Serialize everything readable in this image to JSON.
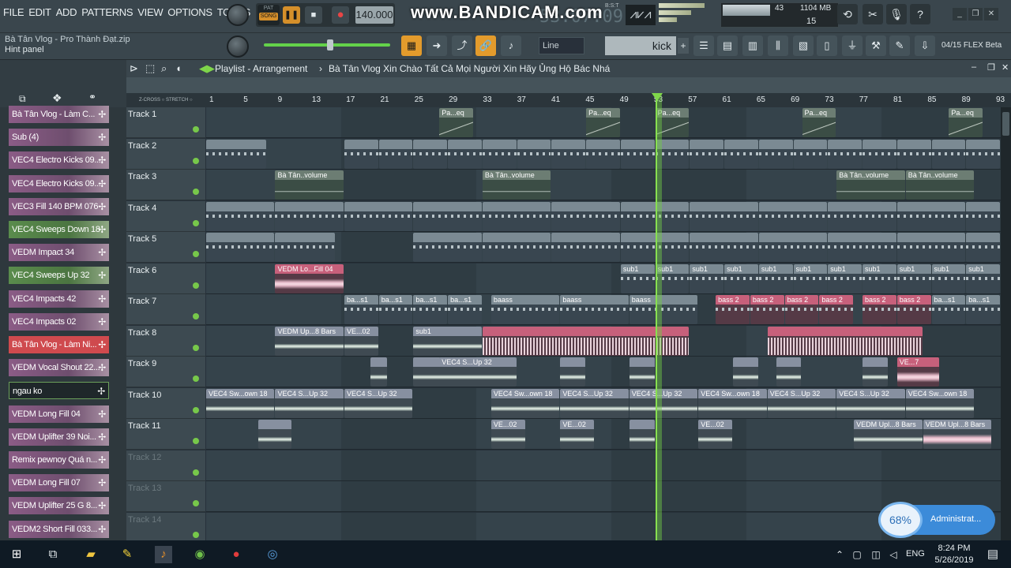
{
  "app": {
    "menu": [
      "FILE",
      "EDIT",
      "ADD",
      "PATTERNS",
      "VIEW",
      "OPTIONS",
      "TOOLS",
      "HELP"
    ],
    "mode_pat": "PAT",
    "mode_song": "SONG",
    "tempo": "140.000",
    "watermark": "www.BANDICAM.com",
    "time_counter": "53:07:09",
    "bst_label": "B:S:T",
    "cpu": {
      "value": "43",
      "ram": "1104 MB",
      "voices": "15"
    },
    "project_file": "Bà Tân Vlog - Pro Thành Đạt.zip",
    "hint_panel": "Hint panel",
    "snap": "Line",
    "selected_channel": "kick",
    "version_label": "04/15",
    "flex_label": "FLEX Beta"
  },
  "playlist": {
    "title": "Playlist - Arrangement",
    "separator": "›",
    "description": "Bà Tân Vlog Xin Chào Tất Cả Mọi Người Xin Hãy Ủng Hộ Bác Nhá",
    "zcross_label": "Z-CROSS",
    "stretch_label": "STRETCH",
    "bars": [
      "1",
      "5",
      "9",
      "13",
      "17",
      "21",
      "25",
      "29",
      "33",
      "37",
      "41",
      "45",
      "49",
      "53",
      "57",
      "61",
      "65",
      "69",
      "73",
      "77",
      "81",
      "85",
      "89",
      "93"
    ],
    "playhead_bar": 53,
    "tracks": [
      "Track 1",
      "Track 2",
      "Track 3",
      "Track 4",
      "Track 5",
      "Track 6",
      "Track 7",
      "Track 8",
      "Track 9",
      "Track 10",
      "Track 11",
      "Track 12",
      "Track 13",
      "Track 14"
    ],
    "clip_labels": {
      "pa_eq": "Pa...eq",
      "ba_tan_volume": "Bà Tân..volume",
      "vedm_lo_fill": "VEDM Lo...Fill 04",
      "sub1": "sub1",
      "ba": "ba...1",
      "bas1": "ba...s1",
      "baass": "baass",
      "ba2": "ba...2",
      "bass2": "bass 2",
      "vedm_up_8": "VEDM Up...8 Bars",
      "ve02": "VE...02",
      "vec4_up32": "VEC4 S...Up 32",
      "ve7": "VE...7",
      "vec4_swoon": "VEC4 Sw...own 18",
      "vedm_upl_8": "VEDM Upl...8 Bars"
    }
  },
  "channels": [
    {
      "name": "Bà Tân Vlog - Làm C...",
      "color": "purple"
    },
    {
      "name": "Sub  (4)",
      "color": "purple"
    },
    {
      "name": "VEC4 Electro Kicks 09...",
      "color": "purple"
    },
    {
      "name": "VEC4 Electro Kicks 09...",
      "color": "purple"
    },
    {
      "name": "VEC3 Fill 140 BPM 076",
      "color": "purple"
    },
    {
      "name": "VEC4 Sweeps Down 18",
      "color": "green"
    },
    {
      "name": "VEDM Impact 34",
      "color": "purple"
    },
    {
      "name": "VEC4 Sweeps Up 32",
      "color": "green"
    },
    {
      "name": "VEC4 Impacts 42",
      "color": "purple"
    },
    {
      "name": "VEC4 Impacts 02",
      "color": "purple"
    },
    {
      "name": "Bà Tân Vlog - Làm Ni...",
      "color": "red"
    },
    {
      "name": "VEDM Vocal Shout 22...",
      "color": "purple"
    },
    {
      "name": "ngau ko",
      "color": "dark"
    },
    {
      "name": "VEDM Long Fill 04",
      "color": "purple"
    },
    {
      "name": "VEDM Uplifter 39 Noi...",
      "color": "purple"
    },
    {
      "name": "Remix pewnoy Quá n...",
      "color": "purple"
    },
    {
      "name": "VEDM Long Fill 07",
      "color": "purple"
    },
    {
      "name": "VEDM Uplifter 25 G 8...",
      "color": "purple"
    },
    {
      "name": "VEDM2 Short Fill 033...",
      "color": "purple"
    }
  ],
  "status": {
    "percent": "68%",
    "label": "Administrat..."
  },
  "taskbar": {
    "lang": "ENG",
    "time": "8:24 PM",
    "date": "5/26/2019"
  },
  "colors": {
    "accent": "#e39b2c",
    "playhead": "#7fd64a",
    "track_dot": "#77c84a"
  }
}
